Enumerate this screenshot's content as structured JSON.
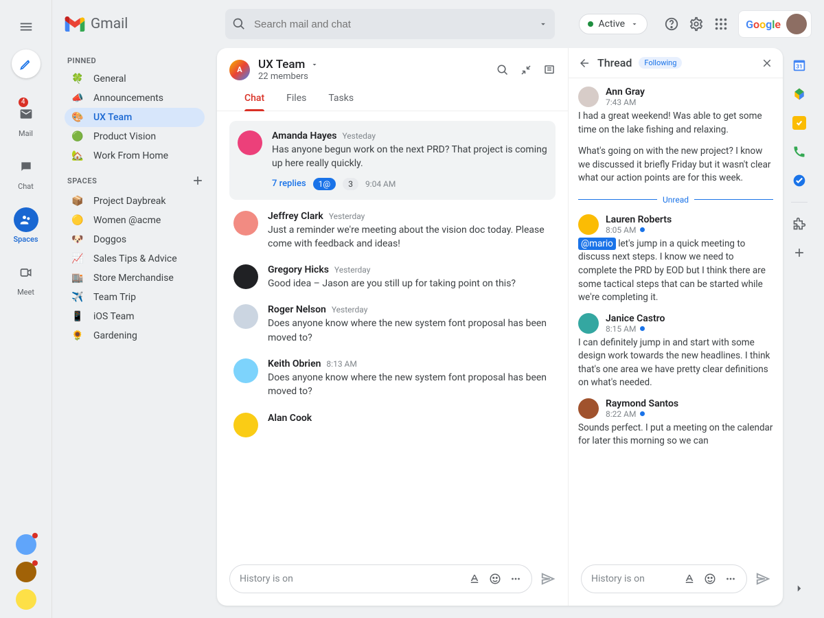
{
  "topbar": {
    "brand": "Gmail",
    "search_placeholder": "Search mail and chat",
    "status_label": "Active"
  },
  "rail": {
    "mail": {
      "label": "Mail",
      "badge": "4"
    },
    "chat": {
      "label": "Chat"
    },
    "spaces": {
      "label": "Spaces"
    },
    "meet": {
      "label": "Meet"
    }
  },
  "sidebar": {
    "pinned_header": "PINNED",
    "spaces_header": "SPACES",
    "pinned": [
      {
        "emoji": "🍀",
        "label": "General"
      },
      {
        "emoji": "📣",
        "label": "Announcements"
      },
      {
        "emoji": "🎨",
        "label": "UX Team"
      },
      {
        "emoji": "🟢",
        "label": "Product Vision"
      },
      {
        "emoji": "🏡",
        "label": "Work From Home"
      }
    ],
    "spaces": [
      {
        "emoji": "📦",
        "label": "Project Daybreak"
      },
      {
        "emoji": "🟡",
        "label": "Women @acme"
      },
      {
        "emoji": "🐶",
        "label": "Doggos"
      },
      {
        "emoji": "📈",
        "label": "Sales Tips & Advice"
      },
      {
        "emoji": "🏬",
        "label": "Store Merchandise"
      },
      {
        "emoji": "✈️",
        "label": "Team Trip"
      },
      {
        "emoji": "📱",
        "label": "iOS Team"
      },
      {
        "emoji": "🌻",
        "label": "Gardening"
      }
    ]
  },
  "space": {
    "title": "UX Team",
    "members": "22 members",
    "tabs": {
      "chat": "Chat",
      "files": "Files",
      "tasks": "Tasks"
    },
    "highlight": {
      "name": "Amanda Hayes",
      "time": "Yesteday",
      "text": "Has anyone begun work on the next PRD? That project is coming up here really quickly.",
      "replies": "7 replies",
      "badge_mention": "1@",
      "badge_count": "3",
      "badge_time": "9:04 AM"
    },
    "messages": [
      {
        "name": "Jeffrey Clark",
        "time": "Yesterday",
        "text": "Just a reminder we're meeting about the vision doc today. Please come with feedback and ideas!",
        "color": "#f28b82"
      },
      {
        "name": "Gregory Hicks",
        "time": "Yesterday",
        "text": "Good idea – Jason are you still up for taking point on this?",
        "color": "#202124"
      },
      {
        "name": "Roger Nelson",
        "time": "Yesterday",
        "text": "Does anyone know where the new system font proposal has been moved to?",
        "color": "#cbd5e1"
      },
      {
        "name": "Keith Obrien",
        "time": "8:13 AM",
        "text": "Does anyone know where the new system font proposal has been moved to?",
        "color": "#7dd3fc"
      },
      {
        "name": "Alan Cook",
        "time": "",
        "text": "",
        "color": "#facc15"
      }
    ],
    "compose": {
      "hint": "History is on"
    }
  },
  "thread": {
    "title": "Thread",
    "badge": "Following",
    "top": {
      "name": "Ann Gray",
      "time": "7:43 AM",
      "text1": "I had a great weekend! Was able to get some time on the lake fishing and relaxing.",
      "text2": "What's going on with the new project? I know we discussed it briefly Friday but it wasn't clear what our action points are for this week."
    },
    "unread_label": "Unread",
    "msgs": [
      {
        "name": "Lauren Roberts",
        "time": "8:05 AM",
        "mention": "@mario",
        "text": " let's jump in a quick meeting to discuss next steps. I know we need to complete the PRD by EOD but I think there are some tactical steps that can be started while we're completing it.",
        "color": "#fbbc04"
      },
      {
        "name": "Janice Castro",
        "time": "8:15 AM",
        "text": "I can definitely jump in and start with some design work towards the new headlines. I think that's one area we have pretty clear definitions on what's needed.",
        "color": "#34a7a1"
      },
      {
        "name": "Raymond Santos",
        "time": "8:22 AM",
        "text": "Sounds perfect. I put a meeting on the calendar for later this morning so we can",
        "color": "#a0522d"
      }
    ],
    "compose": {
      "hint": "History is on"
    }
  }
}
